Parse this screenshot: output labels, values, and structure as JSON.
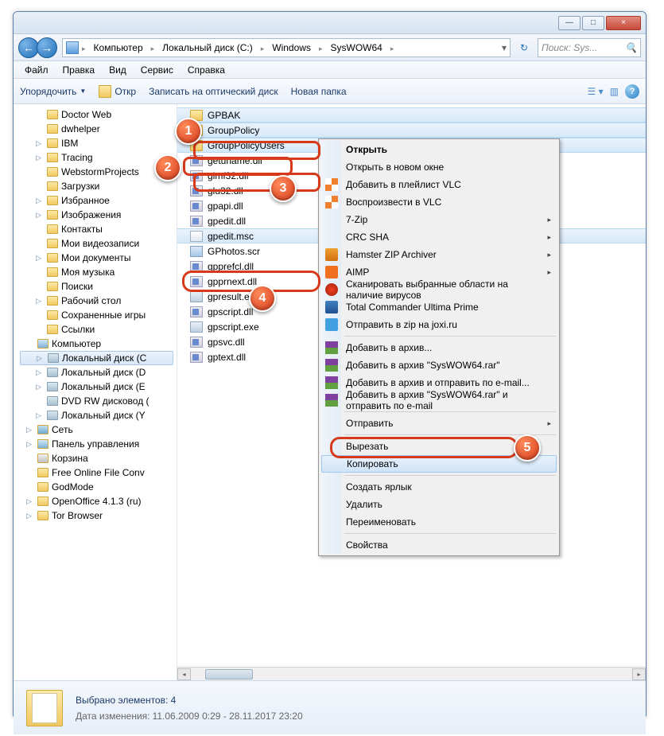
{
  "titlebar": {
    "min": "—",
    "max": "□",
    "close": "×"
  },
  "breadcrumb": {
    "items": [
      "Компьютер",
      "Локальный диск (C:)",
      "Windows",
      "SysWOW64"
    ]
  },
  "search": {
    "placeholder": "Поиск: Sys..."
  },
  "menu": {
    "file": "Файл",
    "edit": "Правка",
    "view": "Вид",
    "tools": "Сервис",
    "help": "Справка"
  },
  "toolbar": {
    "organize": "Упорядочить",
    "open": "Откр",
    "burn": "Записать на оптический диск",
    "newfolder": "Новая папка"
  },
  "tree": [
    {
      "icon": "folder",
      "label": "Doctor Web",
      "lvl": 1
    },
    {
      "icon": "folder",
      "label": "dwhelper",
      "lvl": 1
    },
    {
      "icon": "folder",
      "label": "IBM",
      "lvl": 1,
      "exp": "▷"
    },
    {
      "icon": "folder",
      "label": "Tracing",
      "lvl": 1,
      "exp": "▷"
    },
    {
      "icon": "folder",
      "label": "WebstormProjects",
      "lvl": 1
    },
    {
      "icon": "folder",
      "label": "Загрузки",
      "lvl": 1
    },
    {
      "icon": "folder",
      "label": "Избранное",
      "lvl": 1,
      "exp": "▷"
    },
    {
      "icon": "folder",
      "label": "Изображения",
      "lvl": 1,
      "exp": "▷"
    },
    {
      "icon": "folder",
      "label": "Контакты",
      "lvl": 1
    },
    {
      "icon": "folder",
      "label": "Мои видеозаписи",
      "lvl": 1
    },
    {
      "icon": "folder",
      "label": "Мои документы",
      "lvl": 1,
      "exp": "▷"
    },
    {
      "icon": "folder",
      "label": "Моя музыка",
      "lvl": 1
    },
    {
      "icon": "folder",
      "label": "Поиски",
      "lvl": 1
    },
    {
      "icon": "folder",
      "label": "Рабочий стол",
      "lvl": 1,
      "exp": "▷"
    },
    {
      "icon": "folder",
      "label": "Сохраненные игры",
      "lvl": 1
    },
    {
      "icon": "folder",
      "label": "Ссылки",
      "lvl": 1
    },
    {
      "icon": "pc",
      "label": "Компьютер",
      "lvl": 0,
      "exp": ""
    },
    {
      "icon": "drive",
      "label": "Локальный диск (C",
      "lvl": 1,
      "exp": "▷",
      "sel": true
    },
    {
      "icon": "drive",
      "label": "Локальный диск (D",
      "lvl": 1,
      "exp": "▷"
    },
    {
      "icon": "drive",
      "label": "Локальный диск (E",
      "lvl": 1,
      "exp": "▷"
    },
    {
      "icon": "drive",
      "label": "DVD RW дисковод (",
      "lvl": 1
    },
    {
      "icon": "drive",
      "label": "Локальный диск (Y",
      "lvl": 1,
      "exp": "▷"
    },
    {
      "icon": "net",
      "label": "Сеть",
      "lvl": 0,
      "exp": "▷"
    },
    {
      "icon": "pc",
      "label": "Панель управления",
      "lvl": 0,
      "exp": "▷"
    },
    {
      "icon": "bin",
      "label": "Корзина",
      "lvl": 0
    },
    {
      "icon": "folder",
      "label": "Free Online File Conv",
      "lvl": 0
    },
    {
      "icon": "folder",
      "label": "GodMode",
      "lvl": 0
    },
    {
      "icon": "folder",
      "label": "OpenOffice 4.1.3 (ru)",
      "lvl": 0,
      "exp": "▷"
    },
    {
      "icon": "folder",
      "label": "Tor Browser",
      "lvl": 0,
      "exp": "▷"
    }
  ],
  "files": [
    {
      "icon": "folder",
      "name": "GPBAK",
      "sel": true
    },
    {
      "icon": "folder",
      "name": "GroupPolicy",
      "sel": true
    },
    {
      "icon": "folder",
      "name": "GroupPolicyUsers",
      "sel": true
    },
    {
      "icon": "dll",
      "name": "getuname.dll"
    },
    {
      "icon": "dll",
      "name": "glmf32.dll"
    },
    {
      "icon": "dll",
      "name": "glu32.dll"
    },
    {
      "icon": "dll",
      "name": "gpapi.dll"
    },
    {
      "icon": "dll",
      "name": "gpedit.dll"
    },
    {
      "icon": "msc",
      "name": "gpedit.msc",
      "sel": true
    },
    {
      "icon": "scr",
      "name": "GPhotos.scr"
    },
    {
      "icon": "dll",
      "name": "gpprefcl.dll"
    },
    {
      "icon": "dll",
      "name": "gpprnext.dll"
    },
    {
      "icon": "exe",
      "name": "gpresult.exe"
    },
    {
      "icon": "dll",
      "name": "gpscript.dll"
    },
    {
      "icon": "exe",
      "name": "gpscript.exe"
    },
    {
      "icon": "dll",
      "name": "gpsvc.dll"
    },
    {
      "icon": "dll",
      "name": "gptext.dll"
    }
  ],
  "context": [
    {
      "type": "item",
      "label": "Открыть",
      "bold": true
    },
    {
      "type": "item",
      "label": "Открыть в новом окне"
    },
    {
      "type": "item",
      "label": "Добавить в плейлист VLC",
      "icon": "vlc"
    },
    {
      "type": "item",
      "label": "Воспроизвести в VLC",
      "icon": "vlc"
    },
    {
      "type": "item",
      "label": "7-Zip",
      "sub": true
    },
    {
      "type": "item",
      "label": "CRC SHA",
      "sub": true
    },
    {
      "type": "item",
      "label": "Hamster ZIP Archiver",
      "icon": "zip",
      "sub": true
    },
    {
      "type": "item",
      "label": "AIMP",
      "icon": "aimp",
      "sub": true
    },
    {
      "type": "item",
      "label": "Сканировать выбранные области на наличие вирусов",
      "icon": "av"
    },
    {
      "type": "item",
      "label": "Total Commander Ultima Prime",
      "icon": "tc"
    },
    {
      "type": "item",
      "label": "Отправить в zip на joxi.ru",
      "icon": "joxi"
    },
    {
      "type": "sep"
    },
    {
      "type": "item",
      "label": "Добавить в архив...",
      "icon": "rar"
    },
    {
      "type": "item",
      "label": "Добавить в архив \"SysWOW64.rar\"",
      "icon": "rar"
    },
    {
      "type": "item",
      "label": "Добавить в архив и отправить по e-mail...",
      "icon": "rar"
    },
    {
      "type": "item",
      "label": "Добавить в архив \"SysWOW64.rar\" и отправить по e-mail",
      "icon": "rar"
    },
    {
      "type": "sep"
    },
    {
      "type": "item",
      "label": "Отправить",
      "sub": true
    },
    {
      "type": "sep"
    },
    {
      "type": "item",
      "label": "Вырезать"
    },
    {
      "type": "item",
      "label": "Копировать",
      "hover": true
    },
    {
      "type": "sep"
    },
    {
      "type": "item",
      "label": "Создать ярлык"
    },
    {
      "type": "item",
      "label": "Удалить"
    },
    {
      "type": "item",
      "label": "Переименовать"
    },
    {
      "type": "sep"
    },
    {
      "type": "item",
      "label": "Свойства"
    }
  ],
  "details": {
    "selected": "Выбрано элементов: 4",
    "modified_label": "Дата изменения:",
    "modified_value": "11.06.2009 0:29 - 28.11.2017 23:20"
  },
  "callouts": {
    "1": "1",
    "2": "2",
    "3": "3",
    "4": "4",
    "5": "5"
  }
}
